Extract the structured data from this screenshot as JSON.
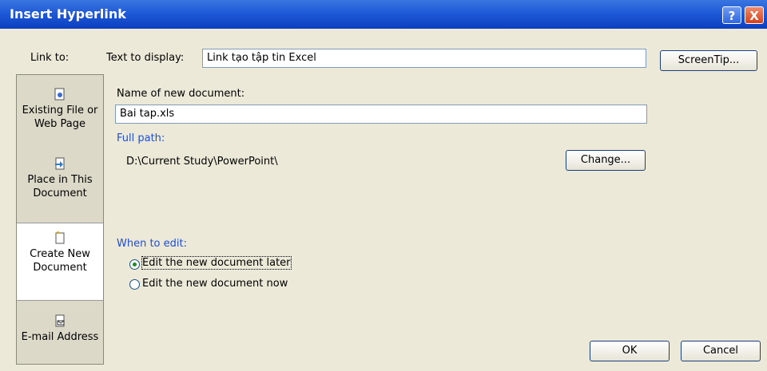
{
  "titlebar": {
    "title": "Insert Hyperlink",
    "help": "?",
    "close": "X"
  },
  "sidebar": {
    "link_to": "Link to:",
    "items": [
      {
        "line1": "Existing File or",
        "line2": "Web Page",
        "icon": "existing-file-icon"
      },
      {
        "line1": "Place in This",
        "line2": "Document",
        "icon": "place-document-icon"
      },
      {
        "line1": "Create New",
        "line2": "Document",
        "icon": "new-document-icon"
      },
      {
        "line1": "E-mail Address",
        "line2": "",
        "icon": "email-icon"
      }
    ],
    "active_index": 2
  },
  "top": {
    "text_to_display_label": "Text to display:",
    "text_to_display_value": "Link tạo tập tin Excel",
    "screentip": "ScreenTip..."
  },
  "main": {
    "name_label": "Name of new document:",
    "name_value": "Bai tap.xls",
    "full_path_label": "Full path:",
    "full_path_value": "D:\\Current Study\\PowerPoint\\",
    "change": "Change...",
    "when_label": "When to edit:",
    "option_later": "Edit the new document later",
    "option_now": "Edit the new document now",
    "selected": "later"
  },
  "footer": {
    "ok": "OK",
    "cancel": "Cancel"
  },
  "colors": {
    "title_bar": "#1f5ad8",
    "dialog_bg": "#ece9d8",
    "label_blue": "#1f4fd0"
  }
}
